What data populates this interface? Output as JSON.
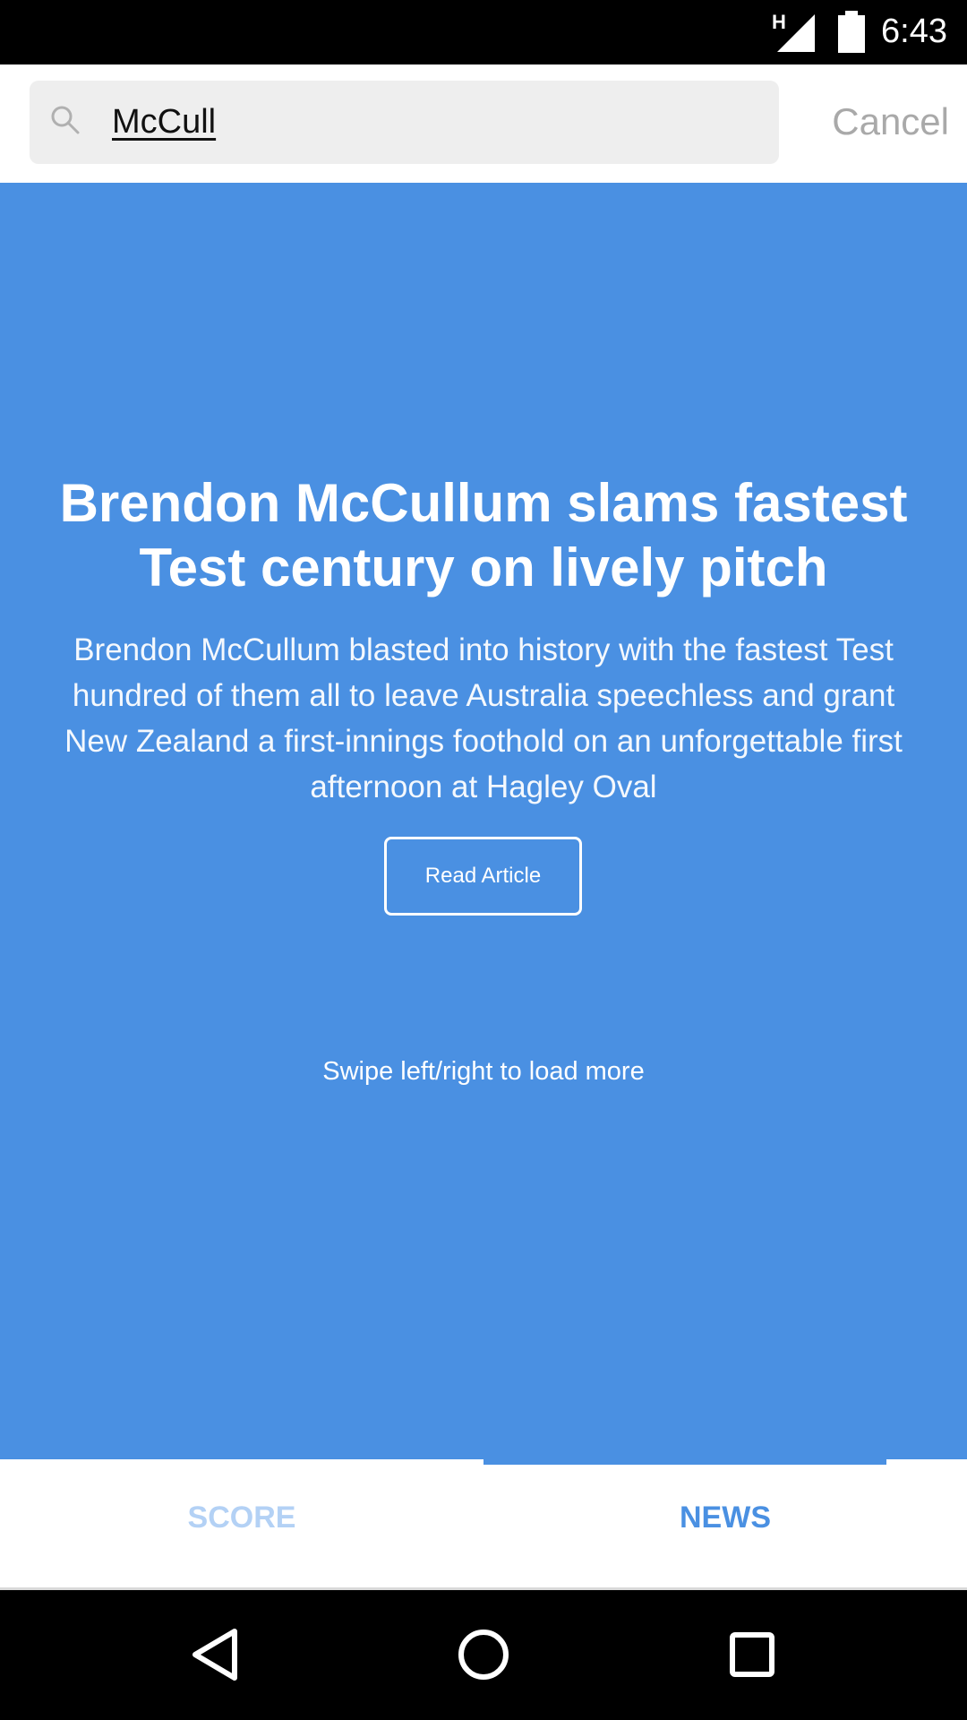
{
  "status_bar": {
    "network_label": "H",
    "time": "6:43",
    "icons": [
      "signal-icon",
      "battery-icon"
    ]
  },
  "search": {
    "value": "McCull",
    "placeholder": "",
    "cancel_label": "Cancel",
    "icon": "search-icon"
  },
  "article": {
    "headline": "Brendon McCullum slams fastest Test century on lively pitch",
    "summary": "Brendon McCullum blasted into history with the fastest Test hundred of them all to leave Australia speechless and grant New Zealand a first-innings foothold on an unforgettable first afternoon at Hagley Oval",
    "read_button_label": "Read Article",
    "swipe_hint": "Swipe left/right to load more"
  },
  "tabs": [
    {
      "label": "SCORE",
      "active": false
    },
    {
      "label": "NEWS",
      "active": true
    }
  ],
  "colors": {
    "accent": "#4a90e2",
    "inactive_tab": "#b3d1f5",
    "search_bg": "#eeeeee",
    "cancel_text": "#a9a9a9"
  },
  "nav_bar": {
    "icons": [
      "back-icon",
      "home-icon",
      "recents-icon"
    ]
  }
}
